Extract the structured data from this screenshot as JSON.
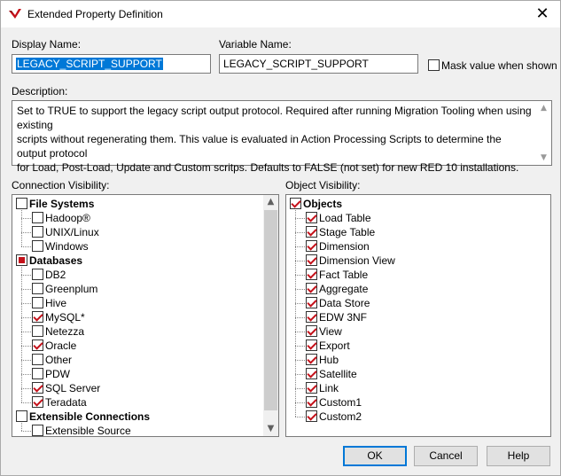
{
  "window": {
    "title": "Extended Property Definition"
  },
  "display_name": {
    "label": "Display Name:",
    "value": "LEGACY_SCRIPT_SUPPORT"
  },
  "variable_name": {
    "label": "Variable Name:",
    "value": "LEGACY_SCRIPT_SUPPORT"
  },
  "mask": {
    "label": "Mask value when shown",
    "checked": false
  },
  "description": {
    "label": "Description:",
    "lines": [
      "Set to TRUE to support the legacy script output protocol. Required after running Migration Tooling when using existing",
      "scripts without regenerating them. This value is evaluated in Action Processing Scripts to determine the output protocol",
      "for Load, Post-Load, Update and Custom scritps. Defaults to FALSE (not set) for new RED 10 installations."
    ]
  },
  "connection_visibility": {
    "label": "Connection Visibility:",
    "items": [
      {
        "text": "File Systems",
        "level": 0,
        "state": "unchecked",
        "bold": true
      },
      {
        "text": "Hadoop®",
        "level": 1,
        "state": "unchecked"
      },
      {
        "text": "UNIX/Linux",
        "level": 1,
        "state": "unchecked"
      },
      {
        "text": "Windows",
        "level": 1,
        "state": "unchecked"
      },
      {
        "text": "Databases",
        "level": 0,
        "state": "partial",
        "bold": true
      },
      {
        "text": "DB2",
        "level": 1,
        "state": "unchecked"
      },
      {
        "text": "Greenplum",
        "level": 1,
        "state": "unchecked"
      },
      {
        "text": "Hive",
        "level": 1,
        "state": "unchecked"
      },
      {
        "text": "MySQL*",
        "level": 1,
        "state": "checked"
      },
      {
        "text": "Netezza",
        "level": 1,
        "state": "unchecked"
      },
      {
        "text": "Oracle",
        "level": 1,
        "state": "checked"
      },
      {
        "text": "Other",
        "level": 1,
        "state": "unchecked"
      },
      {
        "text": "PDW",
        "level": 1,
        "state": "unchecked"
      },
      {
        "text": "SQL Server",
        "level": 1,
        "state": "checked"
      },
      {
        "text": "Teradata",
        "level": 1,
        "state": "checked"
      },
      {
        "text": "Extensible Connections",
        "level": 0,
        "state": "unchecked",
        "bold": true
      },
      {
        "text": "Extensible Source",
        "level": 1,
        "state": "unchecked"
      }
    ]
  },
  "object_visibility": {
    "label": "Object Visibility:",
    "items": [
      {
        "text": "Objects",
        "level": 0,
        "state": "checked",
        "bold": true
      },
      {
        "text": "Load Table",
        "level": 1,
        "state": "checked"
      },
      {
        "text": "Stage Table",
        "level": 1,
        "state": "checked"
      },
      {
        "text": "Dimension",
        "level": 1,
        "state": "checked"
      },
      {
        "text": "Dimension View",
        "level": 1,
        "state": "checked"
      },
      {
        "text": "Fact Table",
        "level": 1,
        "state": "checked"
      },
      {
        "text": "Aggregate",
        "level": 1,
        "state": "checked"
      },
      {
        "text": "Data Store",
        "level": 1,
        "state": "checked"
      },
      {
        "text": "EDW 3NF",
        "level": 1,
        "state": "checked"
      },
      {
        "text": "View",
        "level": 1,
        "state": "checked"
      },
      {
        "text": "Export",
        "level": 1,
        "state": "checked"
      },
      {
        "text": "Hub",
        "level": 1,
        "state": "checked"
      },
      {
        "text": "Satellite",
        "level": 1,
        "state": "checked"
      },
      {
        "text": "Link",
        "level": 1,
        "state": "checked"
      },
      {
        "text": "Custom1",
        "level": 1,
        "state": "checked"
      },
      {
        "text": "Custom2",
        "level": 1,
        "state": "checked"
      }
    ]
  },
  "buttons": {
    "ok": "OK",
    "cancel": "Cancel",
    "help": "Help"
  },
  "icons": {
    "app": "wherescape-logo-icon",
    "close": "close-icon"
  },
  "colors": {
    "selection": "#0078d7",
    "check": "#c4111a"
  }
}
